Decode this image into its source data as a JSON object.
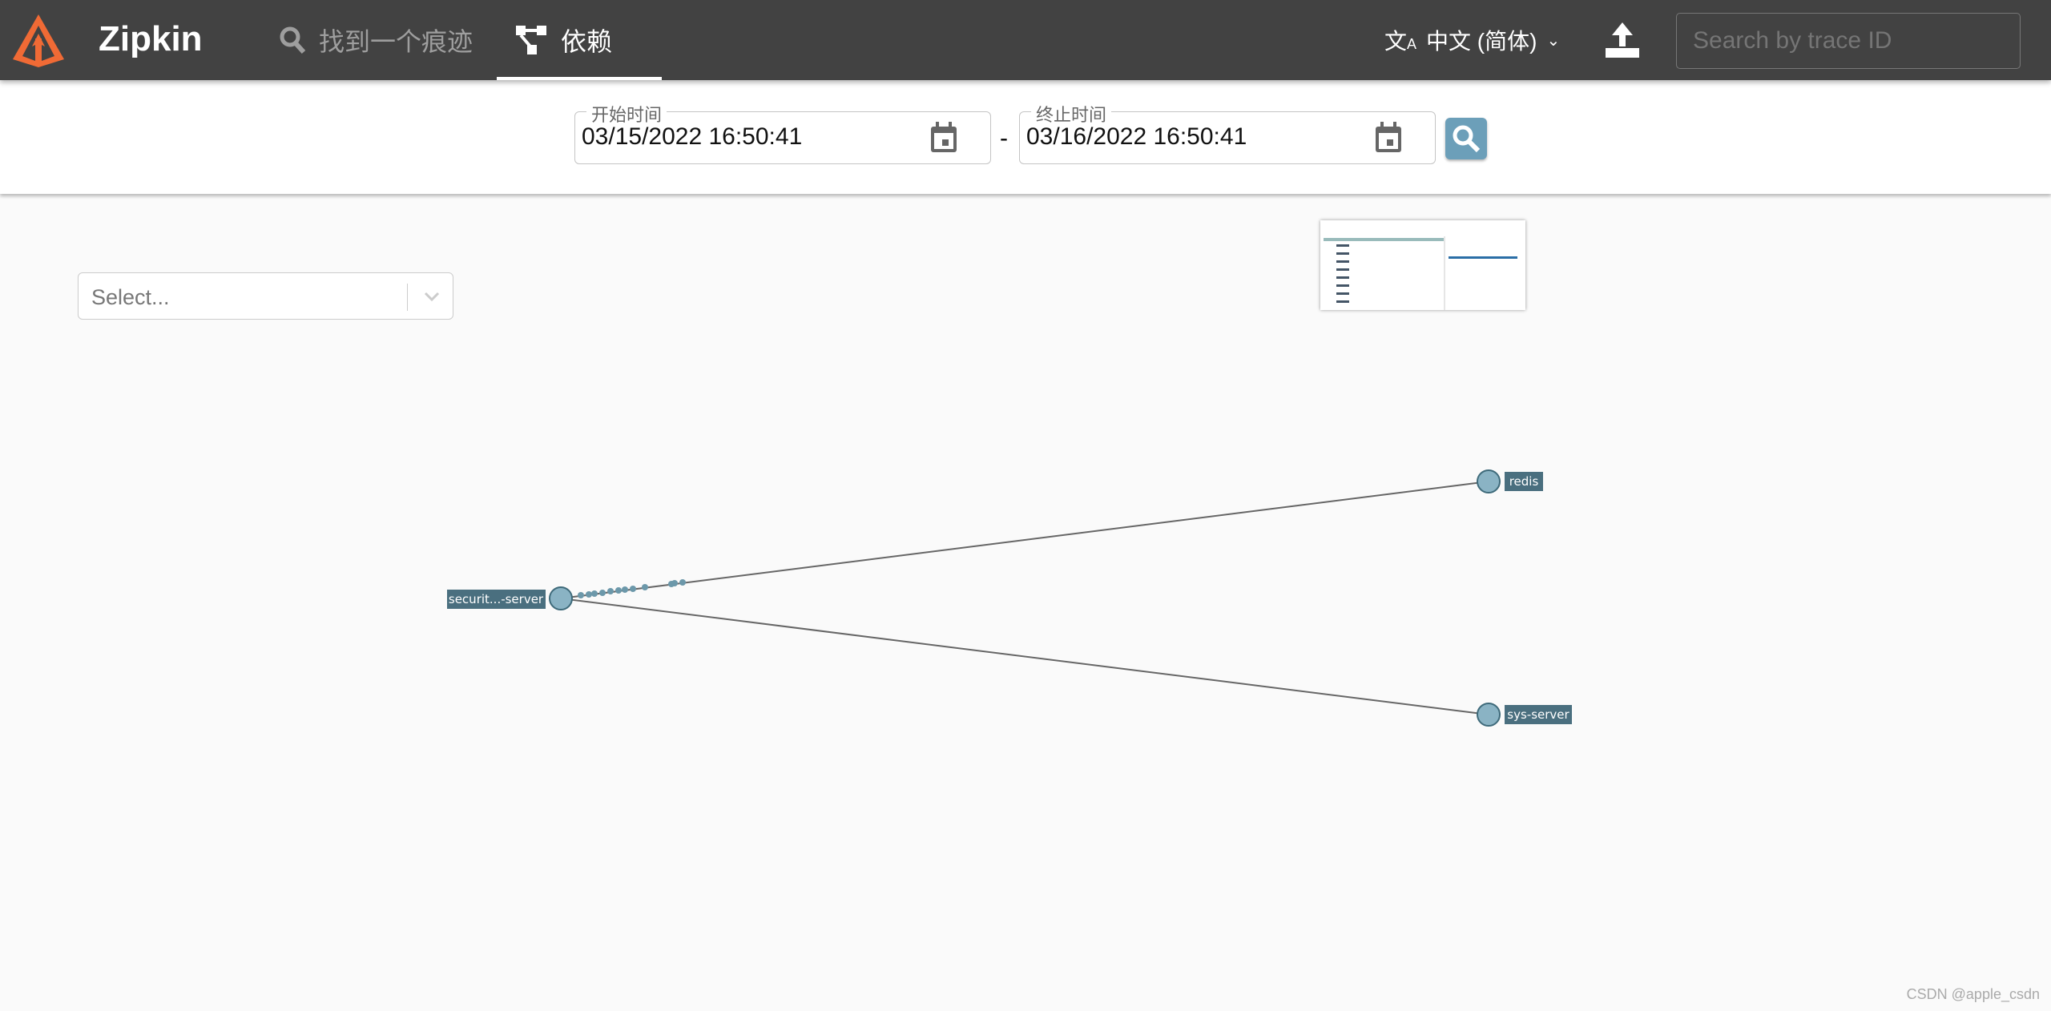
{
  "header": {
    "brand": "Zipkin",
    "nav": [
      {
        "label": "找到一个痕迹",
        "icon": "search-icon"
      },
      {
        "label": "依赖",
        "icon": "dependency-icon",
        "active": true
      }
    ],
    "language": "中文 (简体)",
    "trace_search_placeholder": "Search by trace ID"
  },
  "toolbar": {
    "start_label": "开始时间",
    "start_value": "03/15/2022 16:50:41",
    "separator": "-",
    "end_label": "终止时间",
    "end_value": "03/16/2022 16:50:41"
  },
  "filter": {
    "placeholder": "Select..."
  },
  "graph": {
    "nodes": [
      {
        "id": "security",
        "label": "securit...-server"
      },
      {
        "id": "redis",
        "label": "redis"
      },
      {
        "id": "sys",
        "label": "sys-server"
      }
    ],
    "edges": [
      {
        "from": "security",
        "to": "redis"
      },
      {
        "from": "security",
        "to": "sys"
      }
    ]
  },
  "colors": {
    "header": "#424242",
    "accent": "#6c9fb9",
    "node": "#8ab3c4",
    "node_label": "#4a6f7f",
    "logo": "#f06a35"
  },
  "watermark": "CSDN @apple_csdn"
}
